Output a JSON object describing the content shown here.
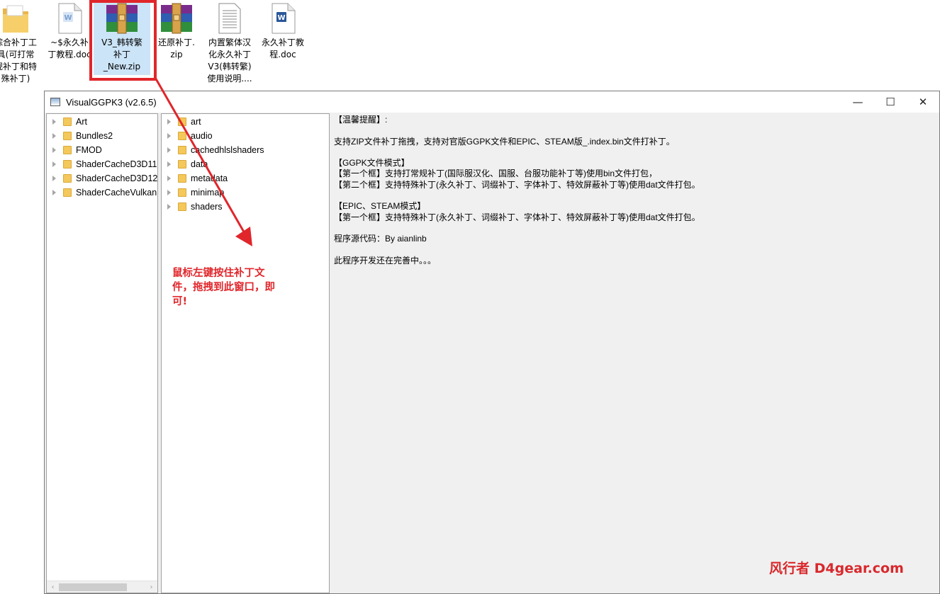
{
  "desktop": {
    "icons": [
      {
        "label": "综合补丁工\n具(可打常\n规补丁和特\n殊补丁)",
        "icon": "folder-icon"
      },
      {
        "label": "~$永久补\n丁教程.doc",
        "icon": "word-doc-icon"
      },
      {
        "label": "V3_韩转繁\n补丁\n_New.zip",
        "icon": "winrar-archive-icon",
        "selected": true
      },
      {
        "label": "还原补丁.\nzip",
        "icon": "winrar-archive-icon"
      },
      {
        "label": "内置繁体汉\n化永久补丁\nV3(韩转繁)\n使用说明....",
        "icon": "text-file-icon"
      },
      {
        "label": "永久补丁教\n程.doc",
        "icon": "word-doc-icon"
      }
    ]
  },
  "window": {
    "title": "VisualGGPK3 (v2.6.5)",
    "controls": {
      "minimize": "—",
      "maximize": "☐",
      "close": "✕"
    }
  },
  "left_tree": [
    "Art",
    "Bundles2",
    "FMOD",
    "ShaderCacheD3D11",
    "ShaderCacheD3D12",
    "ShaderCacheVulkan"
  ],
  "middle_tree": [
    "art",
    "audio",
    "cachedhlslshaders",
    "data",
    "metadata",
    "minimap",
    "shaders"
  ],
  "info_text": [
    "【温馨提醒】:",
    "",
    "支持ZIP文件补丁拖拽，支持对官版GGPK文件和EPIC、STEAM版_.index.bin文件打补丁。",
    "",
    "【GGPK文件模式】",
    "【第一个框】支持打常规补丁(国际服汉化、国服、台服功能补丁等)使用bin文件打包，",
    "【第二个框】支持特殊补丁(永久补丁、词缀补丁、字体补丁、特效屏蔽补丁等)使用dat文件打包。",
    "",
    "【EPIC、STEAM模式】",
    "【第一个框】支持特殊补丁(永久补丁、词缀补丁、字体补丁、特效屏蔽补丁等)使用dat文件打包。",
    "",
    "程序源代码：By aianlinb",
    "",
    "此程序开发还在完善中。。。"
  ],
  "annotation": "鼠标左键按住补丁文件，拖拽到此窗口，即可!",
  "watermark": "风行者 D4gear.com",
  "colors": {
    "accent_red": "#e0262b",
    "selection_blue": "#cce4f7",
    "folder_yellow": "#f4c85a"
  }
}
